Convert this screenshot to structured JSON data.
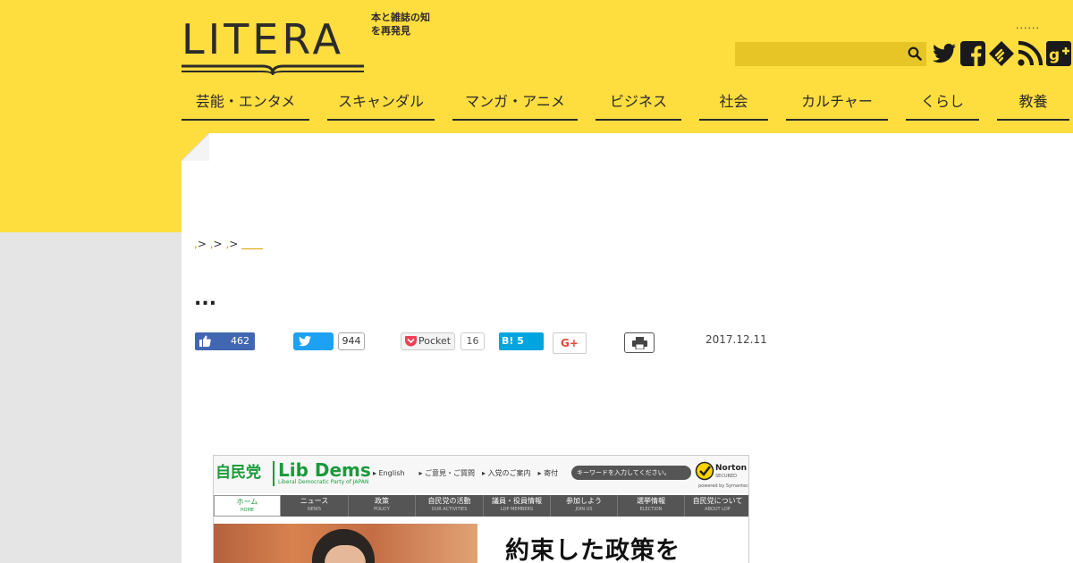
{
  "header": {
    "logo_text": "LITERA",
    "tagline": "本と雑誌の知を再発見",
    "dots": "......",
    "search_placeholder": "",
    "social": [
      "twitter-icon",
      "facebook-icon",
      "feedly-icon",
      "rss-icon",
      "google-plus-icon"
    ]
  },
  "nav": {
    "items": [
      {
        "label": "芸能・エンタメ"
      },
      {
        "label": "スキャンダル"
      },
      {
        "label": "マンガ・アニメ"
      },
      {
        "label": "ビジネス"
      },
      {
        "label": "社会"
      },
      {
        "label": "カルチャー"
      },
      {
        "label": "くらし"
      },
      {
        "label": "教養"
      }
    ]
  },
  "breadcrumb": {
    "items": [
      ",",
      ">",
      ",",
      ">",
      ",",
      ">"
    ],
    "current": "＿＿"
  },
  "article": {
    "title": "...",
    "date": "2017.12.11"
  },
  "share": {
    "facebook_count": "462",
    "twitter_count": "944",
    "pocket_label": "Pocket",
    "pocket_count": "16",
    "hatena_label": "B! 5",
    "gplus_label": "G+"
  },
  "embed": {
    "logo_jp": "自民党",
    "logo_en": "Lib Dems",
    "logo_sub": "Liberal Democratic Party of JAPAN",
    "links": "▸ English　　▸ ご意見・ご質問　▸ 入党のご案内　▸ 寄付",
    "search_placeholder": "キーワードを入力してください。",
    "norton_label": "Norton",
    "norton_sub": "SECURED",
    "norton_powered": "powered by Symantec",
    "nav": [
      {
        "jp": "ホーム",
        "en": "HOME"
      },
      {
        "jp": "ニュース",
        "en": "NEWS"
      },
      {
        "jp": "政策",
        "en": "POLICY"
      },
      {
        "jp": "自民党の活動",
        "en": "OUR ACTIVITIES"
      },
      {
        "jp": "議員・役員情報",
        "en": "LDP MEMBERS"
      },
      {
        "jp": "参加しよう",
        "en": "JOIN US"
      },
      {
        "jp": "選挙情報",
        "en": "ELECTION"
      },
      {
        "jp": "自民党について",
        "en": "ABOUT LDP"
      }
    ],
    "headline": "約束した政策を"
  },
  "colors": {
    "brand_yellow": "#fedd3f",
    "ink": "#2b2b2b",
    "facebook": "#4267b2",
    "twitter": "#1da1f2",
    "hatena": "#00a4de",
    "ldp_green": "#1a9a3b"
  }
}
